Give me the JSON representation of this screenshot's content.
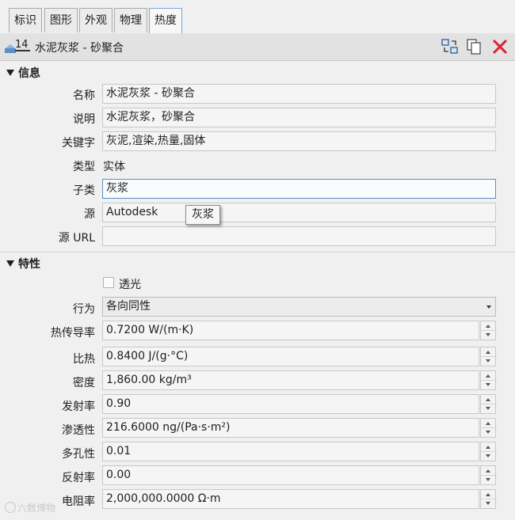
{
  "tabs": [
    "标识",
    "图形",
    "外观",
    "物理",
    "热度"
  ],
  "active_tab": "热度",
  "header": {
    "badge": "14",
    "title": "水泥灰浆 - 砂聚合",
    "icons": [
      "duplicate-icon",
      "copy-icon",
      "close-icon"
    ]
  },
  "info": {
    "section": "信息",
    "rows": [
      {
        "label": "名称",
        "value": "水泥灰浆 - 砂聚合"
      },
      {
        "label": "说明",
        "value": "水泥灰浆，砂聚合"
      },
      {
        "label": "关键字",
        "value": "灰泥,渲染,热量,固体"
      },
      {
        "label": "类型",
        "value": "实体"
      },
      {
        "label": "子类",
        "value": "灰浆"
      },
      {
        "label": "源",
        "value": "Autodesk"
      },
      {
        "label": "源 URL",
        "value": ""
      }
    ],
    "tooltip": "灰浆"
  },
  "props": {
    "section": "特性",
    "transparent_label": "透光",
    "transparent_checked": false,
    "behavior_label": "行为",
    "behavior_value": "各向同性",
    "rows": [
      {
        "label": "热传导率",
        "value": "0.7200 W/(m·K)"
      },
      {
        "label": "比热",
        "value": "0.8400 J/(g·°C)"
      },
      {
        "label": "密度",
        "value": "1,860.00 kg/m³"
      },
      {
        "label": "发射率",
        "value": "0.90"
      },
      {
        "label": "渗透性",
        "value": "216.6000 ng/(Pa·s·m²)"
      },
      {
        "label": "多孔性",
        "value": "0.01"
      },
      {
        "label": "反射率",
        "value": "0.00"
      },
      {
        "label": "电阻率",
        "value": "2,000,000.0000 Ω·m"
      }
    ]
  },
  "watermark": "六数博物",
  "colors": {
    "accent": "#5b8dc9",
    "close": "#d9252b"
  }
}
